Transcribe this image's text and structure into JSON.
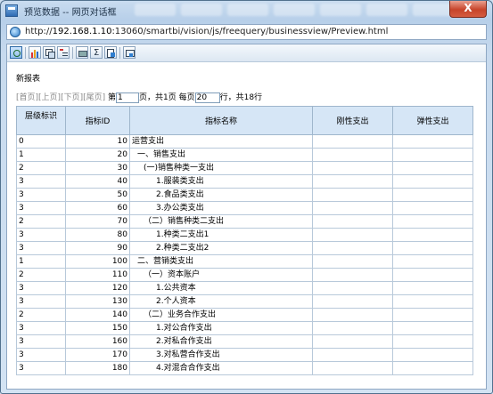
{
  "window": {
    "title": "预览数据 -- 网页对话框",
    "close_label": "X",
    "url_prefix": "http://",
    "url_host": "192.168.1.10",
    "url_rest": ":13060/smartbi/vision/js/freequery/businessview/Preview.html"
  },
  "toolbar": {
    "buttons": [
      {
        "name": "refresh-icon"
      },
      {
        "name": "chart-icon"
      },
      {
        "name": "copy-icon"
      },
      {
        "name": "tree-icon"
      },
      {
        "name": "print-icon"
      },
      {
        "name": "sum-icon"
      },
      {
        "name": "export-icon"
      },
      {
        "name": "move-icon"
      }
    ]
  },
  "report": {
    "title": "新报表"
  },
  "pager": {
    "first": "[首页]",
    "prev": "[上页]",
    "next": "[下页]",
    "last": "[尾页]",
    "page_prefix": "第",
    "page_value": "1",
    "page_suffix": "页，共1页 每页",
    "per_page_value": "20",
    "per_page_suffix": "行，共18行"
  },
  "table": {
    "columns": [
      "层级标识",
      "指标ID",
      "指标名称",
      "刚性支出",
      "弹性支出"
    ],
    "rows": [
      {
        "level": "0",
        "id": "10",
        "name": "运营支出",
        "rigid": "",
        "elastic": ""
      },
      {
        "level": "1",
        "id": "20",
        "name": "一、销售支出",
        "rigid": "",
        "elastic": ""
      },
      {
        "level": "2",
        "id": "30",
        "name": "(一)销售种类一支出",
        "rigid": "",
        "elastic": ""
      },
      {
        "level": "3",
        "id": "40",
        "name": "1.服装类支出",
        "rigid": "",
        "elastic": ""
      },
      {
        "level": "3",
        "id": "50",
        "name": "2.食品类支出",
        "rigid": "",
        "elastic": ""
      },
      {
        "level": "3",
        "id": "60",
        "name": "3.办公类支出",
        "rigid": "",
        "elastic": ""
      },
      {
        "level": "2",
        "id": "70",
        "name": "（二）销售种类二支出",
        "rigid": "",
        "elastic": ""
      },
      {
        "level": "3",
        "id": "80",
        "name": "1.种类二支出1",
        "rigid": "",
        "elastic": ""
      },
      {
        "level": "3",
        "id": "90",
        "name": "2.种类二支出2",
        "rigid": "",
        "elastic": ""
      },
      {
        "level": "1",
        "id": "100",
        "name": "二、营销类支出",
        "rigid": "",
        "elastic": ""
      },
      {
        "level": "2",
        "id": "110",
        "name": "（一）资本账户",
        "rigid": "",
        "elastic": ""
      },
      {
        "level": "3",
        "id": "120",
        "name": "1.公共资本",
        "rigid": "",
        "elastic": ""
      },
      {
        "level": "3",
        "id": "130",
        "name": "2.个人资本",
        "rigid": "",
        "elastic": ""
      },
      {
        "level": "2",
        "id": "140",
        "name": "（二）业务合作支出",
        "rigid": "",
        "elastic": ""
      },
      {
        "level": "3",
        "id": "150",
        "name": "1.对公合作支出",
        "rigid": "",
        "elastic": ""
      },
      {
        "level": "3",
        "id": "160",
        "name": "2.对私合作支出",
        "rigid": "",
        "elastic": ""
      },
      {
        "level": "3",
        "id": "170",
        "name": "3.对私营合作支出",
        "rigid": "",
        "elastic": ""
      },
      {
        "level": "3",
        "id": "180",
        "name": "4.对混合合作支出",
        "rigid": "",
        "elastic": ""
      }
    ]
  }
}
